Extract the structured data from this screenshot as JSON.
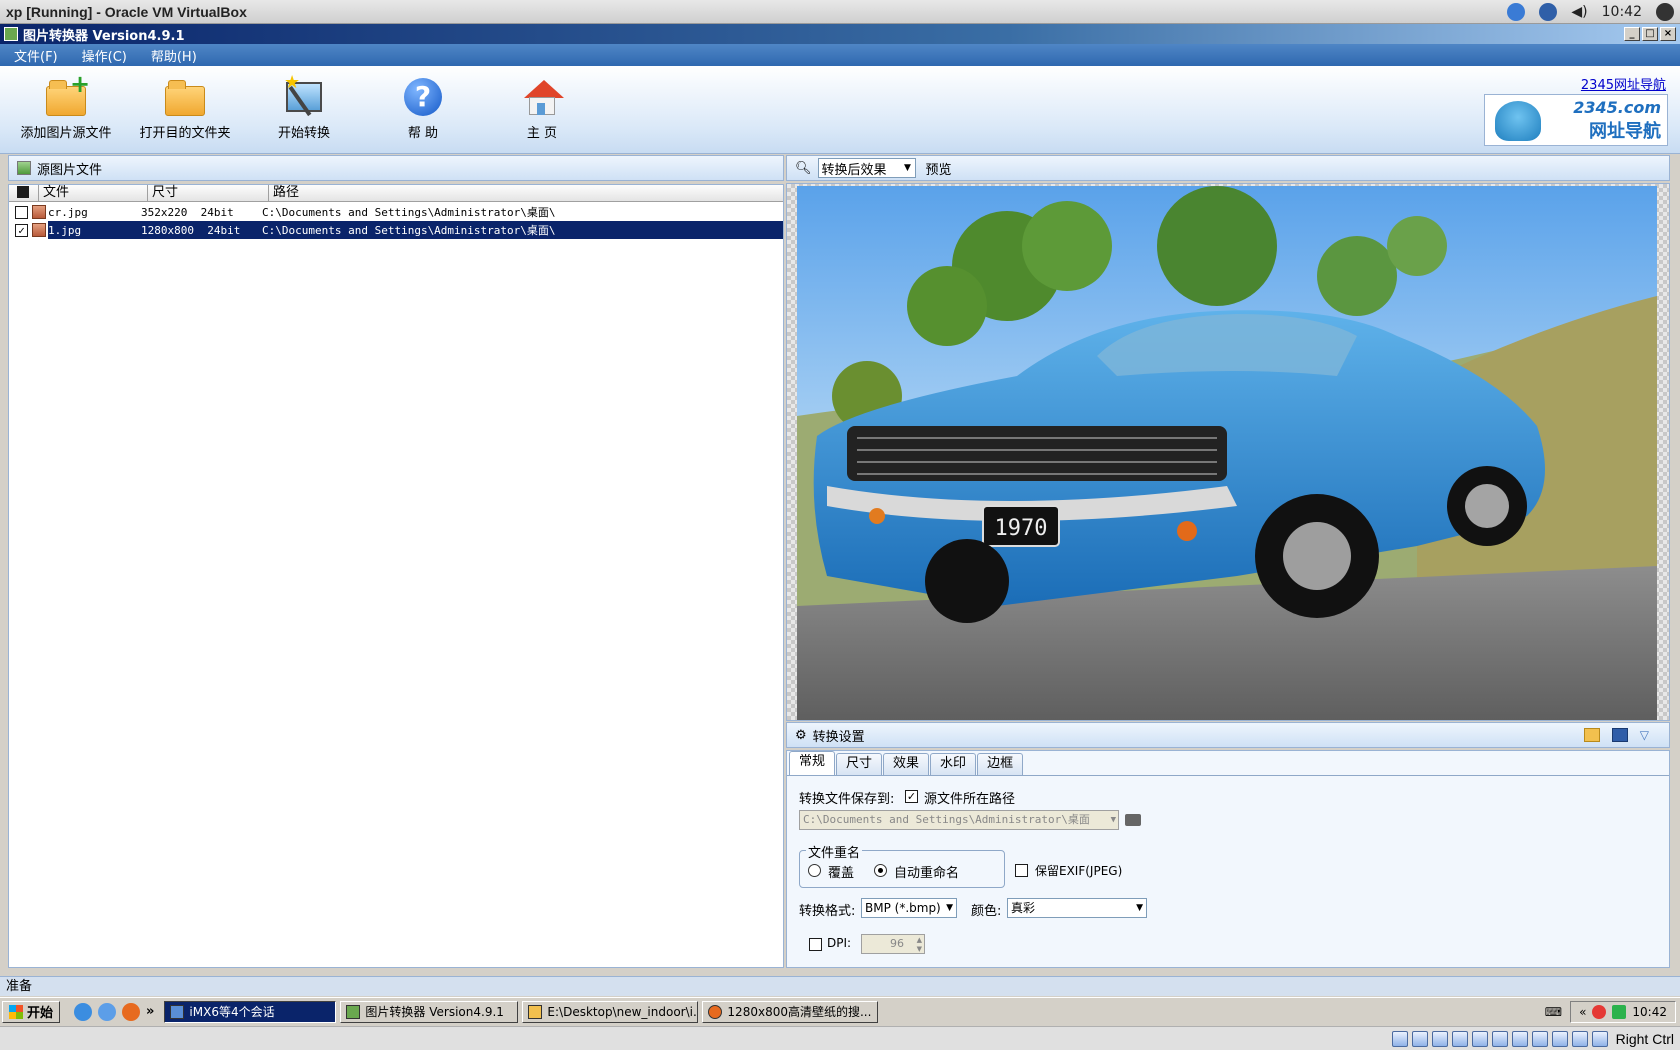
{
  "host": {
    "title": "xp [Running] - Oracle VM VirtualBox",
    "clock": "10:42"
  },
  "window": {
    "title": "图片转换器 Version4.9.1"
  },
  "menu": [
    "文件(F)",
    "操作(C)",
    "帮助(H)"
  ],
  "toolbar": {
    "add_source": "添加图片源文件",
    "open_dest": "打开目的文件夹",
    "start_convert": "开始转换",
    "help": "帮 助",
    "home": "主 页",
    "ad_link": "2345网址导航",
    "ad_logo_top": "2345.com",
    "ad_logo_bottom": "网址导航"
  },
  "source_panel": {
    "title": "源图片文件",
    "columns": [
      "文件",
      "尺寸",
      "路径"
    ],
    "rows": [
      {
        "file": "cr.jpg",
        "size": "352x220  24bit",
        "path": "C:\\Documents and Settings\\Administrator\\桌面\\",
        "checked": false,
        "selected": false
      },
      {
        "file": "1.jpg",
        "size": "1280x800  24bit",
        "path": "C:\\Documents and Settings\\Administrator\\桌面\\",
        "checked": true,
        "selected": true
      }
    ]
  },
  "preview": {
    "mode": "转换后效果",
    "label": "预览",
    "plate": "1970"
  },
  "settings": {
    "title": "转换设置",
    "tabs": [
      "常规",
      "尺寸",
      "效果",
      "水印",
      "边框"
    ],
    "active_tab": "常规",
    "save_to_label": "转换文件保存到:",
    "source_path_option": "源文件所在路径",
    "source_path_checked": true,
    "dest_path": "C:\\Documents and Settings\\Administrator\\桌面",
    "rename_group": "文件重名",
    "rename_overwrite": "覆盖",
    "rename_auto": "自动重命名",
    "rename_selected": "自动重命名",
    "keep_exif": "保留EXIF(JPEG)",
    "keep_exif_checked": false,
    "format_label": "转换格式:",
    "format_value": "BMP (*.bmp)",
    "color_label": "颜色:",
    "color_value": "真彩",
    "dpi_label": "DPI:",
    "dpi_checked": false,
    "dpi_value": "96"
  },
  "status": {
    "text": "准备"
  },
  "taskbar": {
    "start": "开始",
    "tasks": [
      {
        "label": "iMX6等4个会话",
        "active": true
      },
      {
        "label": "图片转换器 Version4.9.1",
        "active": false
      },
      {
        "label": "E:\\Desktop\\new_indoor\\i...",
        "active": false
      },
      {
        "label": "1280x800高清壁纸的搜...",
        "active": false
      }
    ],
    "clock": "10:42"
  },
  "vbox": {
    "host_key": "Right Ctrl"
  }
}
